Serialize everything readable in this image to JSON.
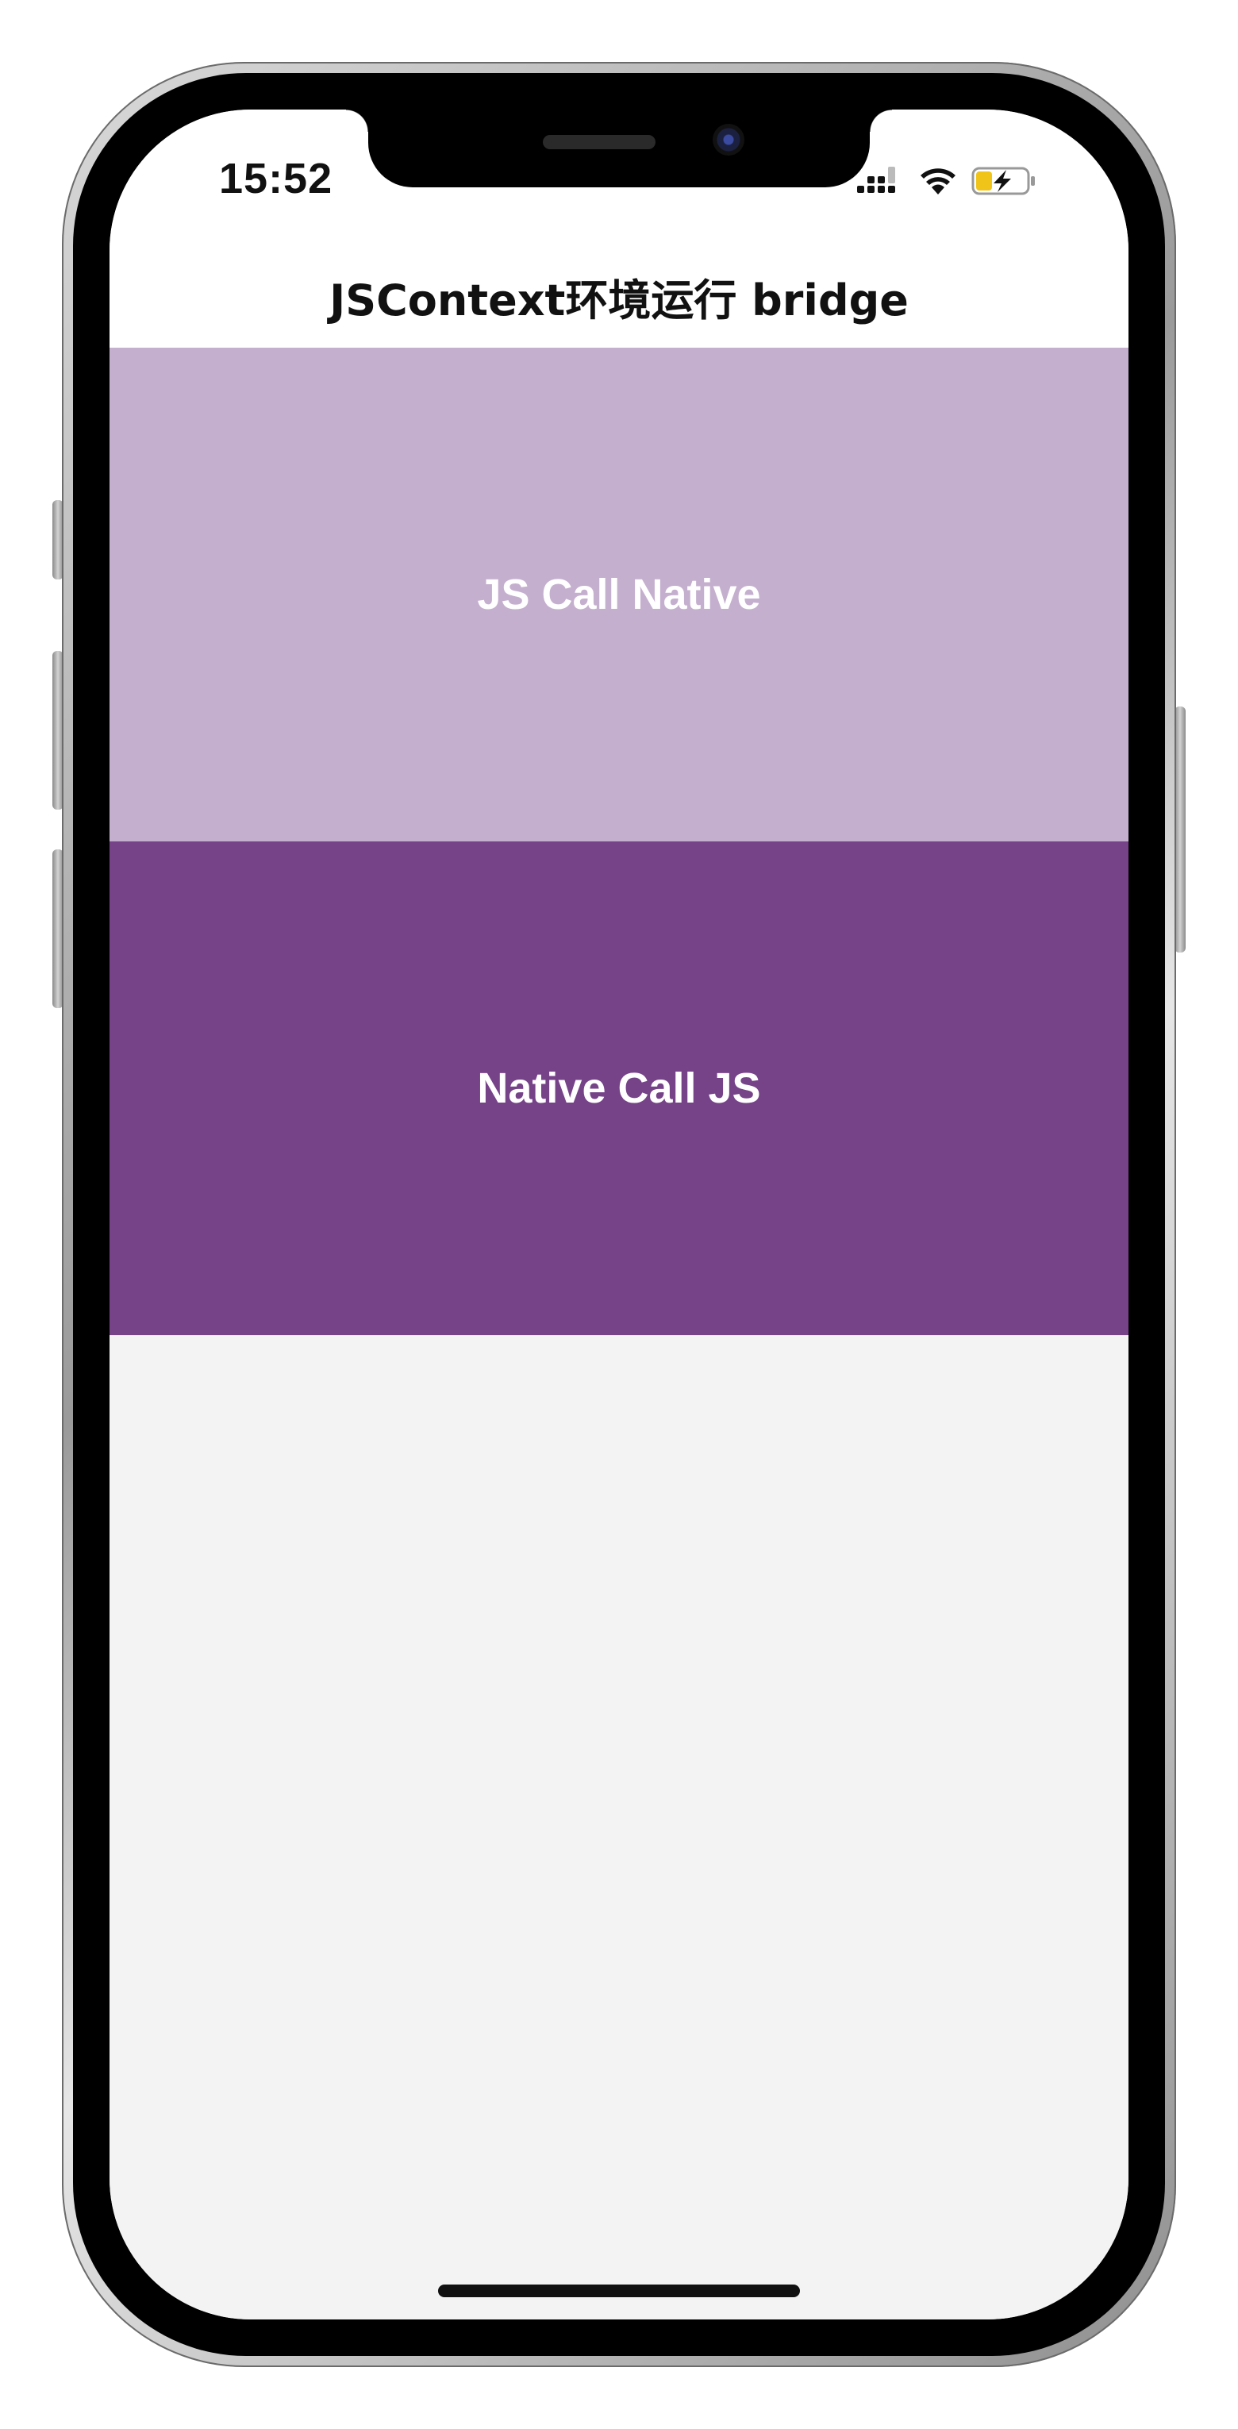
{
  "status_bar": {
    "time": "15:52",
    "signal_icon": "cellular-signal-icon",
    "wifi_icon": "wifi-icon",
    "battery_icon": "battery-charging-icon"
  },
  "nav": {
    "title": "JSContext环境运行 bridge"
  },
  "actions": [
    {
      "label": "JS Call Native",
      "color": "#c5afcf"
    },
    {
      "label": "Native Call JS",
      "color": "#764389"
    }
  ],
  "colors": {
    "background": "#f3f3f3",
    "nav_background": "#ffffff",
    "label_text": "#ffffff"
  }
}
